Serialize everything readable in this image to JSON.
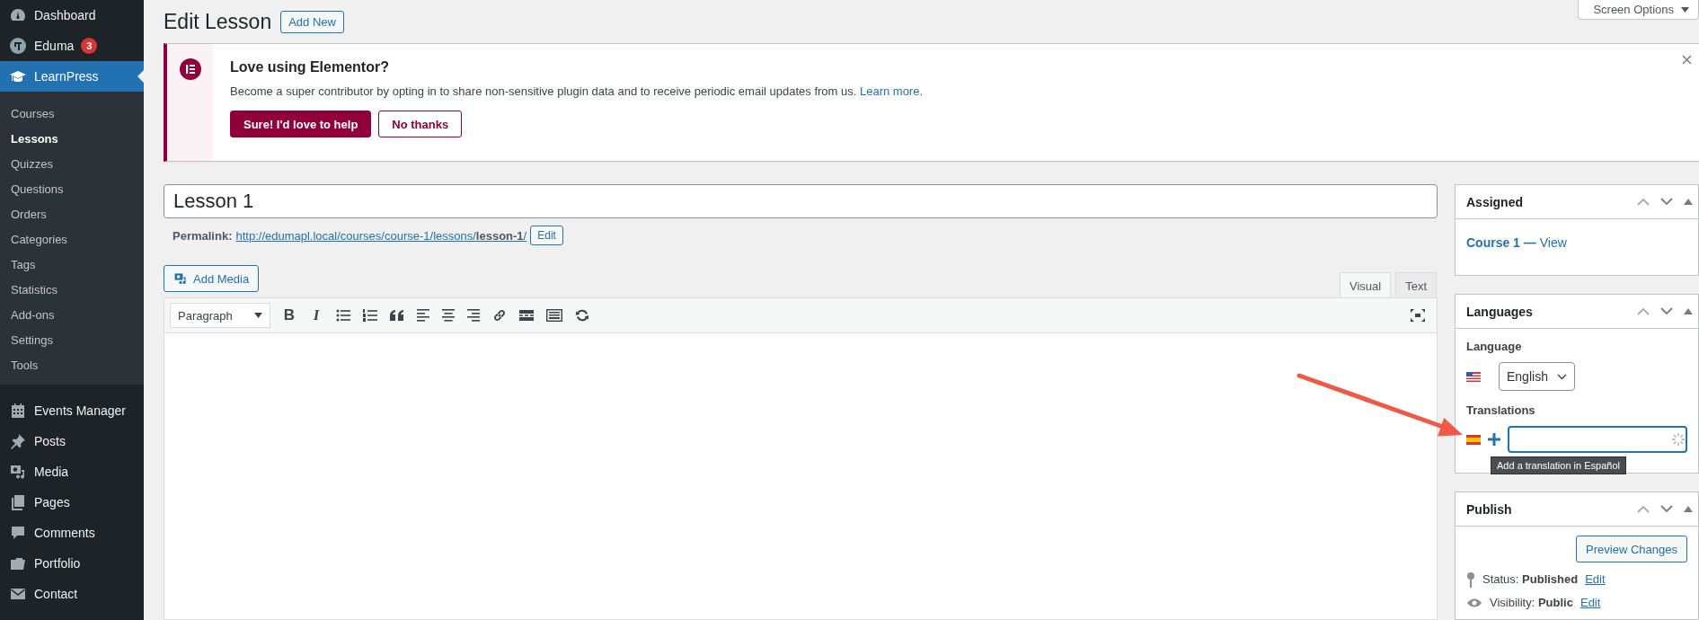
{
  "sidebar": {
    "items": [
      {
        "label": "Dashboard",
        "selected": false
      },
      {
        "label": "Eduma",
        "badge": "3",
        "selected": false
      },
      {
        "label": "LearnPress",
        "selected": true,
        "children": [
          {
            "label": "Courses",
            "selected": false
          },
          {
            "label": "Lessons",
            "selected": true
          },
          {
            "label": "Quizzes",
            "selected": false
          },
          {
            "label": "Questions",
            "selected": false
          },
          {
            "label": "Orders",
            "selected": false
          },
          {
            "label": "Categories",
            "selected": false
          },
          {
            "label": "Tags",
            "selected": false
          },
          {
            "label": "Statistics",
            "selected": false
          },
          {
            "label": "Add-ons",
            "selected": false
          },
          {
            "label": "Settings",
            "selected": false
          },
          {
            "label": "Tools",
            "selected": false
          }
        ]
      },
      {
        "label": "Events Manager",
        "selected": false
      },
      {
        "label": "Posts",
        "selected": false
      },
      {
        "label": "Media",
        "selected": false
      },
      {
        "label": "Pages",
        "selected": false
      },
      {
        "label": "Comments",
        "selected": false
      },
      {
        "label": "Portfolio",
        "selected": false
      },
      {
        "label": "Contact",
        "selected": false
      }
    ]
  },
  "screen_options": {
    "label": "Screen Options"
  },
  "page": {
    "title": "Edit Lesson",
    "add_new": "Add New"
  },
  "notice": {
    "title": "Love using Elementor?",
    "text": "Become a super contributor by opting in to share non-sensitive plugin data and to receive periodic email updates from us.",
    "link": "Learn more.",
    "buttons": [
      "Sure! I'd love to help",
      "No thanks"
    ]
  },
  "post": {
    "title": "Lesson 1",
    "permalink_label": "Permalink:",
    "permalink": "http://edumapl.local/courses/course-1/lessons/**lesson-1**/",
    "permalink_edit": "Edit"
  },
  "editor": {
    "add_media": "Add Media",
    "tabs": [
      {
        "label": "Visual",
        "selected": true
      },
      {
        "label": "Text",
        "selected": false
      }
    ],
    "format": "Paragraph",
    "toolbar": [
      {
        "kind": "bold",
        "glyph": "B"
      },
      {
        "kind": "italic",
        "glyph": "I"
      },
      {
        "kind": "bullets"
      },
      {
        "kind": "numbers"
      },
      {
        "kind": "quote"
      },
      {
        "kind": "align-left"
      },
      {
        "kind": "align-center"
      },
      {
        "kind": "align-right"
      },
      {
        "kind": "link"
      },
      {
        "kind": "more"
      },
      {
        "kind": "keyboard"
      },
      {
        "kind": "refresh"
      }
    ]
  },
  "assigned": {
    "title": "Assigned",
    "link": "**Course 1 —** View"
  },
  "languages": {
    "title": "Languages",
    "language_label": "Language",
    "language": "English",
    "translations_label": "Translations",
    "tooltip": "Add a translation in Español"
  },
  "publish": {
    "title": "Publish",
    "preview": "Preview Changes",
    "rows": [
      {
        "kind": "status",
        "text": "Status: **Published**",
        "link": "Edit"
      },
      {
        "kind": "visibility",
        "text": "Visibility: **Public**",
        "link": "Edit"
      }
    ]
  }
}
